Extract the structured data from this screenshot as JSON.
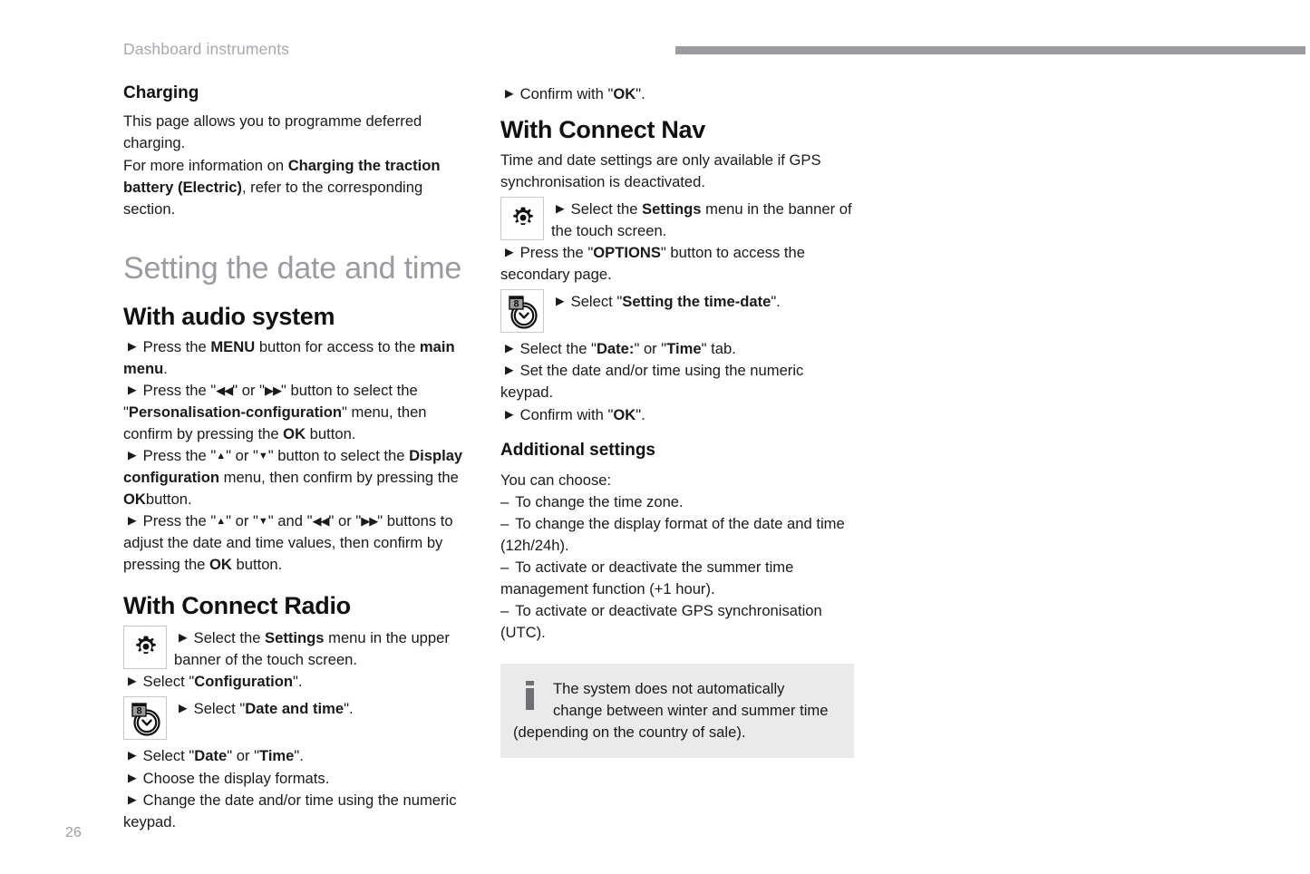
{
  "header": {
    "title": "Dashboard instruments"
  },
  "page_number": "26",
  "left_column": {
    "charging": {
      "heading": "Charging",
      "para1": "This page allows you to programme deferred charging.",
      "para2_pre": "For more information on ",
      "para2_bold": "Charging the traction battery (Electric)",
      "para2_post": ", refer to the corresponding section."
    },
    "section_title": "Setting the date and time",
    "audio_system": {
      "heading": "With audio system",
      "step1_pre": "Press the ",
      "step1_bold": "MENU",
      "step1_mid": " button for access to the ",
      "step1_bold2": "main menu",
      "step1_post": ".",
      "step2_pre": "Press the \"",
      "step2_glyph_a": "◀◀",
      "step2_mid": "\" or \"",
      "step2_glyph_b": "▶▶",
      "step2_mid2": "\" button to select the \"",
      "step2_bold": "Personalisation-configuration",
      "step2_post": "\" menu, then confirm by pressing the ",
      "step2_bold2": "OK",
      "step2_end": " button.",
      "step3_pre": "Press the \"",
      "step3_glyph_a": "▲",
      "step3_mid": "\" or \"",
      "step3_glyph_b": "▼",
      "step3_mid2": "\" button to select the ",
      "step3_bold": "Display configuration",
      "step3_post": " menu, then confirm by pressing the ",
      "step3_bold2": "OK",
      "step3_end": "button.",
      "step4_pre": "Press the \"",
      "step4_glyph_a": "▲",
      "step4_mid": "\" or \"",
      "step4_glyph_b": "▼",
      "step4_mid2": "\" and \"",
      "step4_glyph_c": "◀◀",
      "step4_mid3": "\" or \"",
      "step4_glyph_d": "▶▶",
      "step4_mid4": "\" buttons to adjust the date and time values, then confirm by pressing the ",
      "step4_bold": "OK",
      "step4_end": " button."
    },
    "connect_radio": {
      "heading": "With Connect Radio",
      "icon_settings": "gear-icon",
      "step1_pre": "Select the ",
      "step1_bold": "Settings",
      "step1_post": " menu in the upper banner of the touch screen.",
      "step2_pre": "Select \"",
      "step2_bold": "Configuration",
      "step2_post": "\".",
      "icon_datetime": "calendar-clock-icon",
      "step3_pre": "Select \"",
      "step3_bold": "Date and time",
      "step3_post": "\".",
      "step4_pre": "Select \"",
      "step4_bold": "Date",
      "step4_mid": "\" or \"",
      "step4_bold2": "Time",
      "step4_post": "\".",
      "step5": "Choose the display formats.",
      "step6": "Change the date and/or time using the numeric keypad."
    }
  },
  "right_column": {
    "confirm_top_pre": "Confirm with \"",
    "confirm_top_bold": "OK",
    "confirm_top_post": "\".",
    "connect_nav": {
      "heading": "With Connect Nav",
      "intro": "Time and date settings are only available if GPS synchronisation is deactivated.",
      "icon_settings": "gear-icon",
      "step1_pre": "Select the ",
      "step1_bold": "Settings",
      "step1_post": " menu in the banner of the touch screen.",
      "step2_pre": "Press the \"",
      "step2_bold": "OPTIONS",
      "step2_post": "\" button to access the secondary page.",
      "icon_datetime": "calendar-clock-icon",
      "step3_pre": "Select \"",
      "step3_bold": "Setting the time-date",
      "step3_post": "\".",
      "step4_pre": "Select the \"",
      "step4_bold": "Date:",
      "step4_mid": "\" or \"",
      "step4_bold2": "Time",
      "step4_post": "\" tab.",
      "step5": "Set the date and/or time using the numeric keypad.",
      "step6_pre": "Confirm with \"",
      "step6_bold": "OK",
      "step6_post": "\"."
    },
    "additional_settings": {
      "heading": "Additional settings",
      "intro": "You can choose:",
      "items": [
        "To change the time zone.",
        "To change the display format of the date and time (12h/24h).",
        "To activate or deactivate the summer time management function (+1 hour).",
        "To activate or deactivate GPS synchronisation (UTC)."
      ]
    },
    "note": {
      "icon": "info-icon",
      "line1": "The system does not automatically",
      "line2": "change between winter and summer time",
      "line3": "(depending on the country of sale)."
    }
  },
  "colors": {
    "header_rule": "#9b9ca0",
    "header_text": "#a7a9ae",
    "section_title": "#9a9ba0",
    "note_background": "#eaeaea",
    "note_icon": "#6e7074",
    "body_text": "#1a1a1a"
  }
}
